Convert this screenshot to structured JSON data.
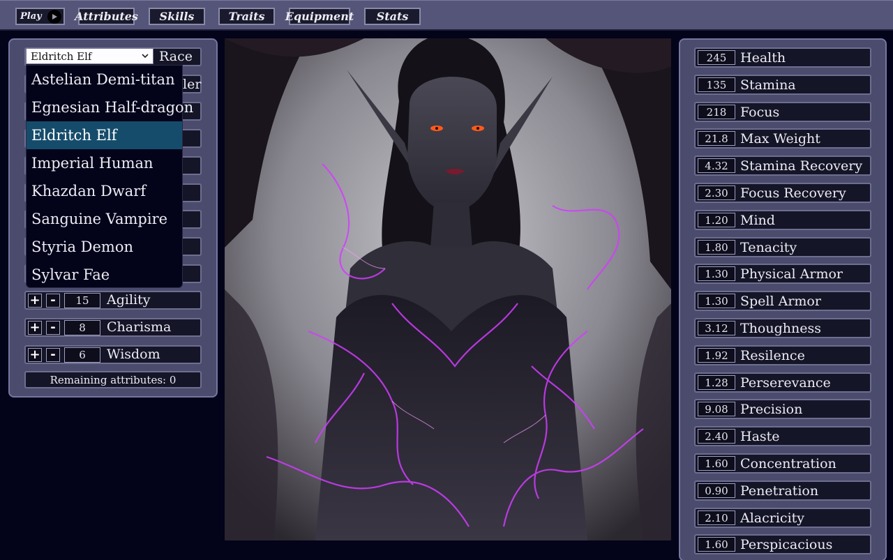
{
  "nav": {
    "play_label": "Play",
    "tabs": [
      "Attributes",
      "Skills",
      "Traits",
      "Equipment",
      "Stats"
    ]
  },
  "left": {
    "race_value": "Eldritch Elf",
    "race_label": "Race",
    "partial_label_2": "ler",
    "race_options": [
      "Astelian Demi-titan",
      "Egnesian Half-dragon",
      "Eldritch Elf",
      "Imperial Human",
      "Khazdan Dwarf",
      "Sanguine Vampire",
      "Styria Demon",
      "Sylvar Fae"
    ],
    "selected_index": 2,
    "attributes": [
      {
        "value": "15",
        "name": "Agility"
      },
      {
        "value": "8",
        "name": "Charisma"
      },
      {
        "value": "6",
        "name": "Wisdom"
      }
    ],
    "plus": "+",
    "minus": "-",
    "remaining": "Remaining attributes: 0"
  },
  "stats": [
    {
      "value": "245",
      "name": "Health"
    },
    {
      "value": "135",
      "name": "Stamina"
    },
    {
      "value": "218",
      "name": "Focus"
    },
    {
      "value": "21.8",
      "name": "Max Weight"
    },
    {
      "value": "4.32",
      "name": "Stamina Recovery"
    },
    {
      "value": "2.30",
      "name": "Focus Recovery"
    },
    {
      "value": "1.20",
      "name": "Mind"
    },
    {
      "value": "1.80",
      "name": "Tenacity"
    },
    {
      "value": "1.30",
      "name": "Physical Armor"
    },
    {
      "value": "1.30",
      "name": "Spell Armor"
    },
    {
      "value": "3.12",
      "name": "Thoughness"
    },
    {
      "value": "1.92",
      "name": "Resilence"
    },
    {
      "value": "1.28",
      "name": "Perserevance"
    },
    {
      "value": "9.08",
      "name": "Precision"
    },
    {
      "value": "2.40",
      "name": "Haste"
    },
    {
      "value": "1.60",
      "name": "Concentration"
    },
    {
      "value": "0.90",
      "name": "Penetration"
    },
    {
      "value": "2.10",
      "name": "Alacricity"
    },
    {
      "value": "1.60",
      "name": "Perspicacious"
    }
  ],
  "colors": {
    "background": "#03031a",
    "panel": "#4b4b6e",
    "topbar": "#55557a",
    "selected_option": "#164c6b",
    "magic_purple": "#d23cff",
    "eye_glow": "#ff5a1a"
  }
}
